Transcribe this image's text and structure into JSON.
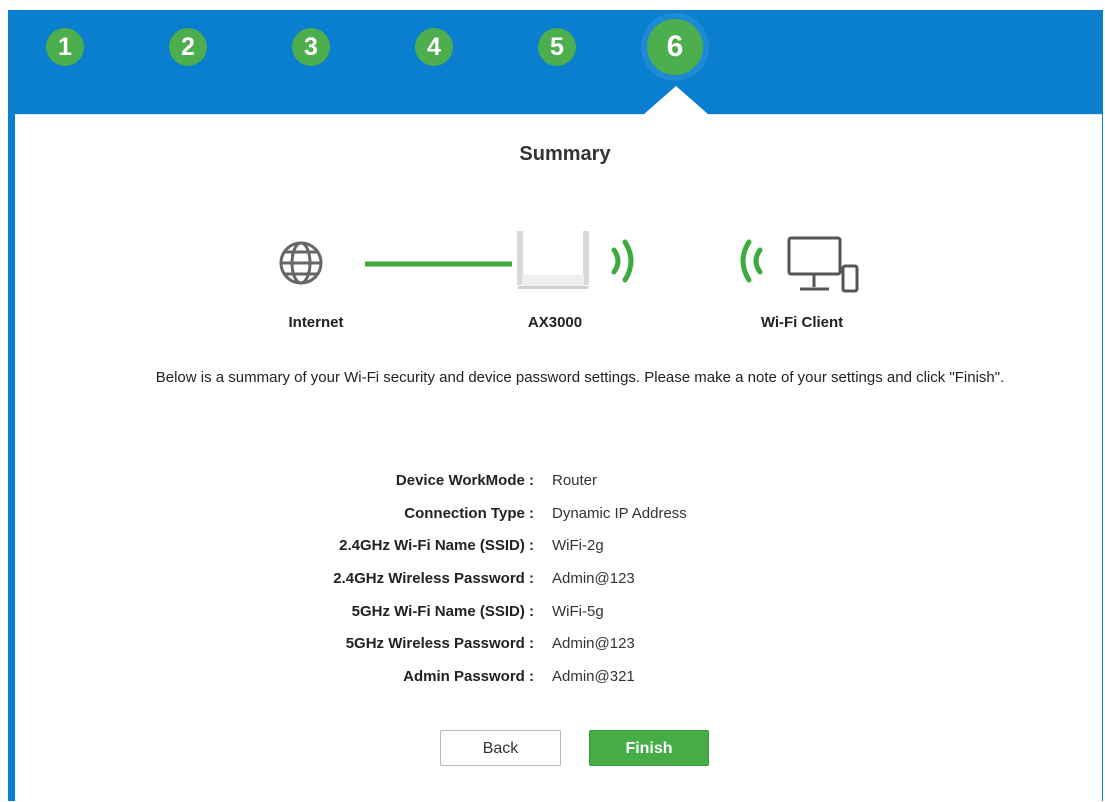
{
  "steps": [
    "1",
    "2",
    "3",
    "4",
    "5",
    "6"
  ],
  "active_step": "6",
  "title": "Summary",
  "diagram": {
    "internet_label": "Internet",
    "router_label": "AX3000",
    "client_label": "Wi-Fi Client"
  },
  "description": "Below is a summary of your Wi-Fi security and device password settings. Please make a note of your settings and click \"Finish\".",
  "summary": [
    {
      "label": "Device WorkMode :",
      "value": "Router"
    },
    {
      "label": "Connection Type :",
      "value": "Dynamic IP Address"
    },
    {
      "label": "2.4GHz Wi-Fi Name (SSID) :",
      "value": "WiFi-2g"
    },
    {
      "label": "2.4GHz Wireless Password :",
      "value": "Admin@123"
    },
    {
      "label": "5GHz Wi-Fi Name (SSID) :",
      "value": "WiFi-5g"
    },
    {
      "label": "5GHz Wireless Password :",
      "value": "Admin@123"
    },
    {
      "label": "Admin Password :",
      "value": "Admin@321"
    }
  ],
  "buttons": {
    "back": "Back",
    "finish": "Finish"
  },
  "colors": {
    "header_blue": "#0a7fd0",
    "step_green": "#4cae4c",
    "link_green": "#3daa3d",
    "finish_green": "#46ad46"
  },
  "icons": [
    "globe-icon",
    "router-icon",
    "wifi-signal-icon",
    "monitor-phone-icon"
  ]
}
